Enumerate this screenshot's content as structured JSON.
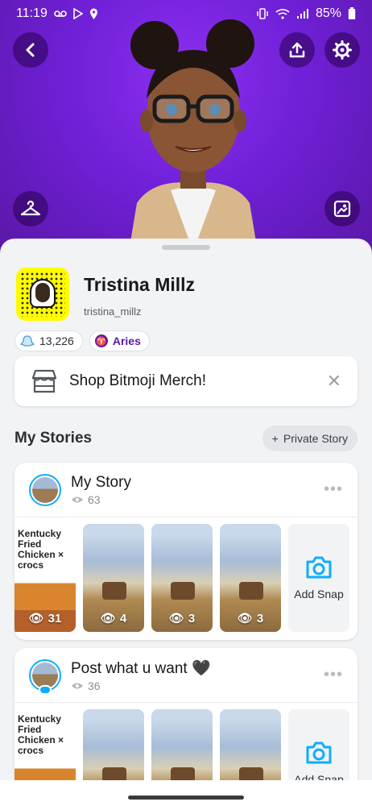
{
  "status_bar": {
    "time": "11:19",
    "battery": "85%"
  },
  "profile": {
    "name": "Tristina Millz",
    "username": "tristina_millz"
  },
  "chips": {
    "score": "13,226",
    "zodiac": "Aries"
  },
  "merch": {
    "label": "Shop Bitmoji Merch!"
  },
  "stories_section": {
    "title": "My Stories",
    "private_story_label": "Private Story"
  },
  "stories": [
    {
      "title": "My Story",
      "views": "63",
      "snaps": [
        {
          "views": "31"
        },
        {
          "views": "4"
        },
        {
          "views": "3"
        },
        {
          "views": "3"
        }
      ],
      "add_snap_label": "Add Snap"
    },
    {
      "title": "Post what u want 🖤",
      "views": "36",
      "snaps": [
        {
          "views": ""
        },
        {
          "views": ""
        },
        {
          "views": ""
        },
        {
          "views": ""
        }
      ],
      "add_snap_label": "Add Snap"
    }
  ],
  "snap_text": {
    "kfc": "Kentucky Fried Chicken × crocs"
  },
  "colors": {
    "hero_purple": "#7020d8",
    "accent_blue": "#0fadff",
    "snap_yellow": "#fffc00"
  },
  "icons": [
    "back-icon",
    "share-icon",
    "settings-icon",
    "hanger-icon",
    "photo-edit-icon",
    "eye-icon",
    "camera-icon",
    "close-icon",
    "plus-icon",
    "store-icon"
  ]
}
